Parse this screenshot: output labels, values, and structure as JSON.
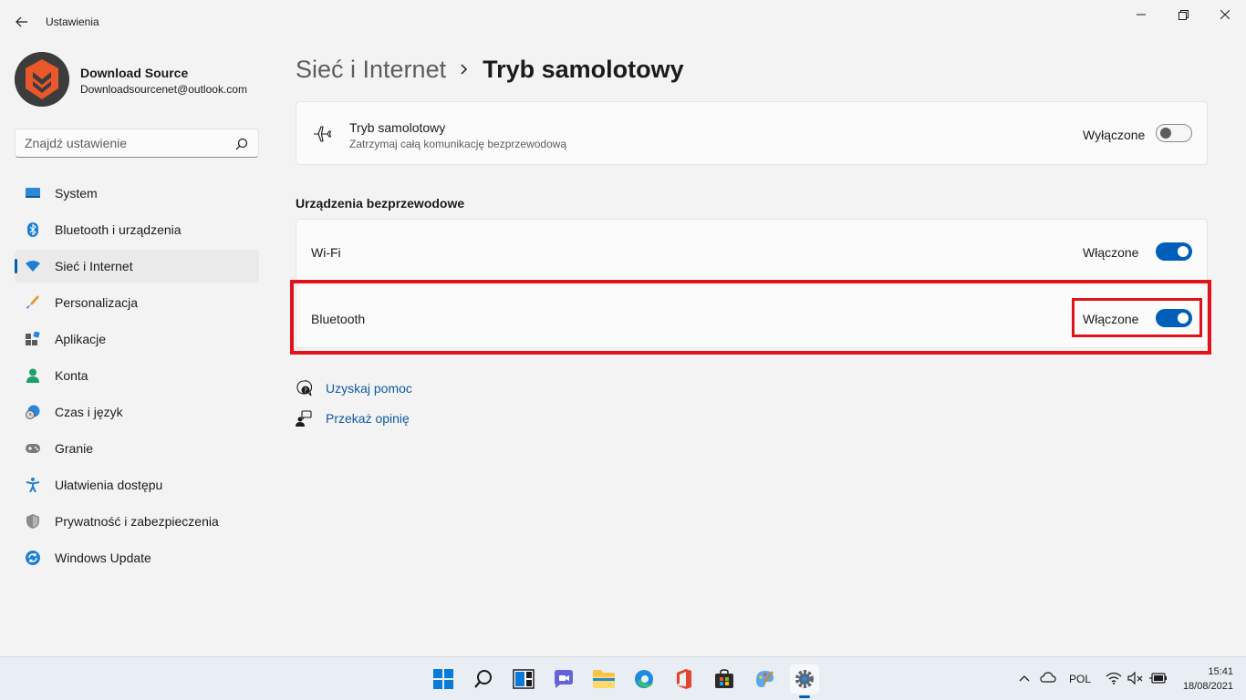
{
  "window": {
    "title": "Ustawienia"
  },
  "profile": {
    "name": "Download Source",
    "email": "Downloadsourcenet@outlook.com"
  },
  "search": {
    "placeholder": "Znajdź ustawienie"
  },
  "sidebar": {
    "items": [
      {
        "label": "System",
        "icon": "system-icon"
      },
      {
        "label": "Bluetooth i urządzenia",
        "icon": "bluetooth-icon"
      },
      {
        "label": "Sieć i Internet",
        "icon": "network-icon",
        "active": true
      },
      {
        "label": "Personalizacja",
        "icon": "brush-icon"
      },
      {
        "label": "Aplikacje",
        "icon": "apps-icon"
      },
      {
        "label": "Konta",
        "icon": "account-icon"
      },
      {
        "label": "Czas i język",
        "icon": "time-language-icon"
      },
      {
        "label": "Granie",
        "icon": "gaming-icon"
      },
      {
        "label": "Ułatwienia dostępu",
        "icon": "accessibility-icon"
      },
      {
        "label": "Prywatność i zabezpieczenia",
        "icon": "shield-icon"
      },
      {
        "label": "Windows Update",
        "icon": "windows-update-icon"
      }
    ]
  },
  "breadcrumb": {
    "parent": "Sieć i Internet",
    "current": "Tryb samolotowy"
  },
  "airplane": {
    "title": "Tryb samolotowy",
    "subtitle": "Zatrzymaj całą komunikację bezprzewodową",
    "state": "Wyłączone",
    "on": false
  },
  "wireless": {
    "section_title": "Urządzenia bezprzewodowe",
    "wifi": {
      "label": "Wi-Fi",
      "state": "Włączone",
      "on": true
    },
    "bluetooth": {
      "label": "Bluetooth",
      "state": "Włączone",
      "on": true
    }
  },
  "links": {
    "help": "Uzyskaj pomoc",
    "feedback": "Przekaż opinię"
  },
  "taskbar": {
    "apps": [
      "start-icon",
      "search-icon",
      "task-view-icon",
      "chat-icon",
      "file-explorer-icon",
      "edge-icon",
      "office-icon",
      "store-icon",
      "paint-icon",
      "settings-icon"
    ],
    "language": "POL",
    "time": "15:41",
    "date": "18/08/2021"
  },
  "colors": {
    "accent": "#005fb8",
    "highlight": "#e0131b",
    "link": "#0e5aa6"
  }
}
